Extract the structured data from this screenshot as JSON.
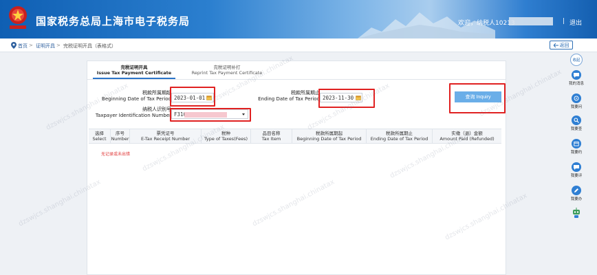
{
  "header": {
    "site_title": "国家税务总局上海市电子税务局",
    "welcome_text": "欢迎，纳税人10213",
    "separator": "|",
    "logout_label": "退出",
    "colors": {
      "start": "#0f5fb3",
      "end": "#145fb0"
    }
  },
  "breadcrumb": {
    "items": [
      "首页",
      "证明开具",
      "完税证明开具（表格式）"
    ],
    "separator": ">",
    "back_label": "返回"
  },
  "tabs": [
    {
      "label_cn": "完税证明开具",
      "label_en": "Issue Tax Payment Certificate",
      "active": true
    },
    {
      "label_cn": "完税证明补打",
      "label_en": "Reprint Tax Payment Certificate",
      "active": false
    }
  ],
  "form": {
    "begin_date": {
      "label_cn": "税款所属期起",
      "label_en": "Beginning Date of Tax Period",
      "value": "2023-01-01"
    },
    "end_date": {
      "label_cn": "税款所属期止",
      "label_en": "Ending Date of Tax Period",
      "value": "2023-11-30"
    },
    "tin": {
      "label_cn": "纳税人识别号",
      "label_en": "Taxpayer Identification Number",
      "value": "F310"
    },
    "inquiry_label": "查询 Inquiry"
  },
  "table": {
    "headers": [
      {
        "cn": "选择",
        "en": "Select"
      },
      {
        "cn": "序号",
        "en": "Number"
      },
      {
        "cn": "票凭证号",
        "en": "E-Tax Receipt Number"
      },
      {
        "cn": "税种",
        "en": "Type of Taxes(Fees)"
      },
      {
        "cn": "品目名称",
        "en": "Tax Item"
      },
      {
        "cn": "税款所属期起",
        "en": "Beginning Date of Tax Period"
      },
      {
        "cn": "税款所属期止",
        "en": "Ending Date of Tax Period"
      },
      {
        "cn": "实缴（退）金额",
        "en": "Amount Paid (Refunded)"
      }
    ],
    "empty_text": "无记录或未出错"
  },
  "sidebar": {
    "collapse_label": "收起",
    "items": [
      {
        "label": "我的消息",
        "icon": "message-icon"
      },
      {
        "label": "我要问",
        "icon": "question-icon"
      },
      {
        "label": "我要查",
        "icon": "search-icon"
      },
      {
        "label": "我要约",
        "icon": "appointment-icon"
      },
      {
        "label": "我要评",
        "icon": "rate-icon"
      },
      {
        "label": "我要办",
        "icon": "edit-icon"
      }
    ]
  },
  "watermark": "dzswjcs.shanghai.chinatax"
}
